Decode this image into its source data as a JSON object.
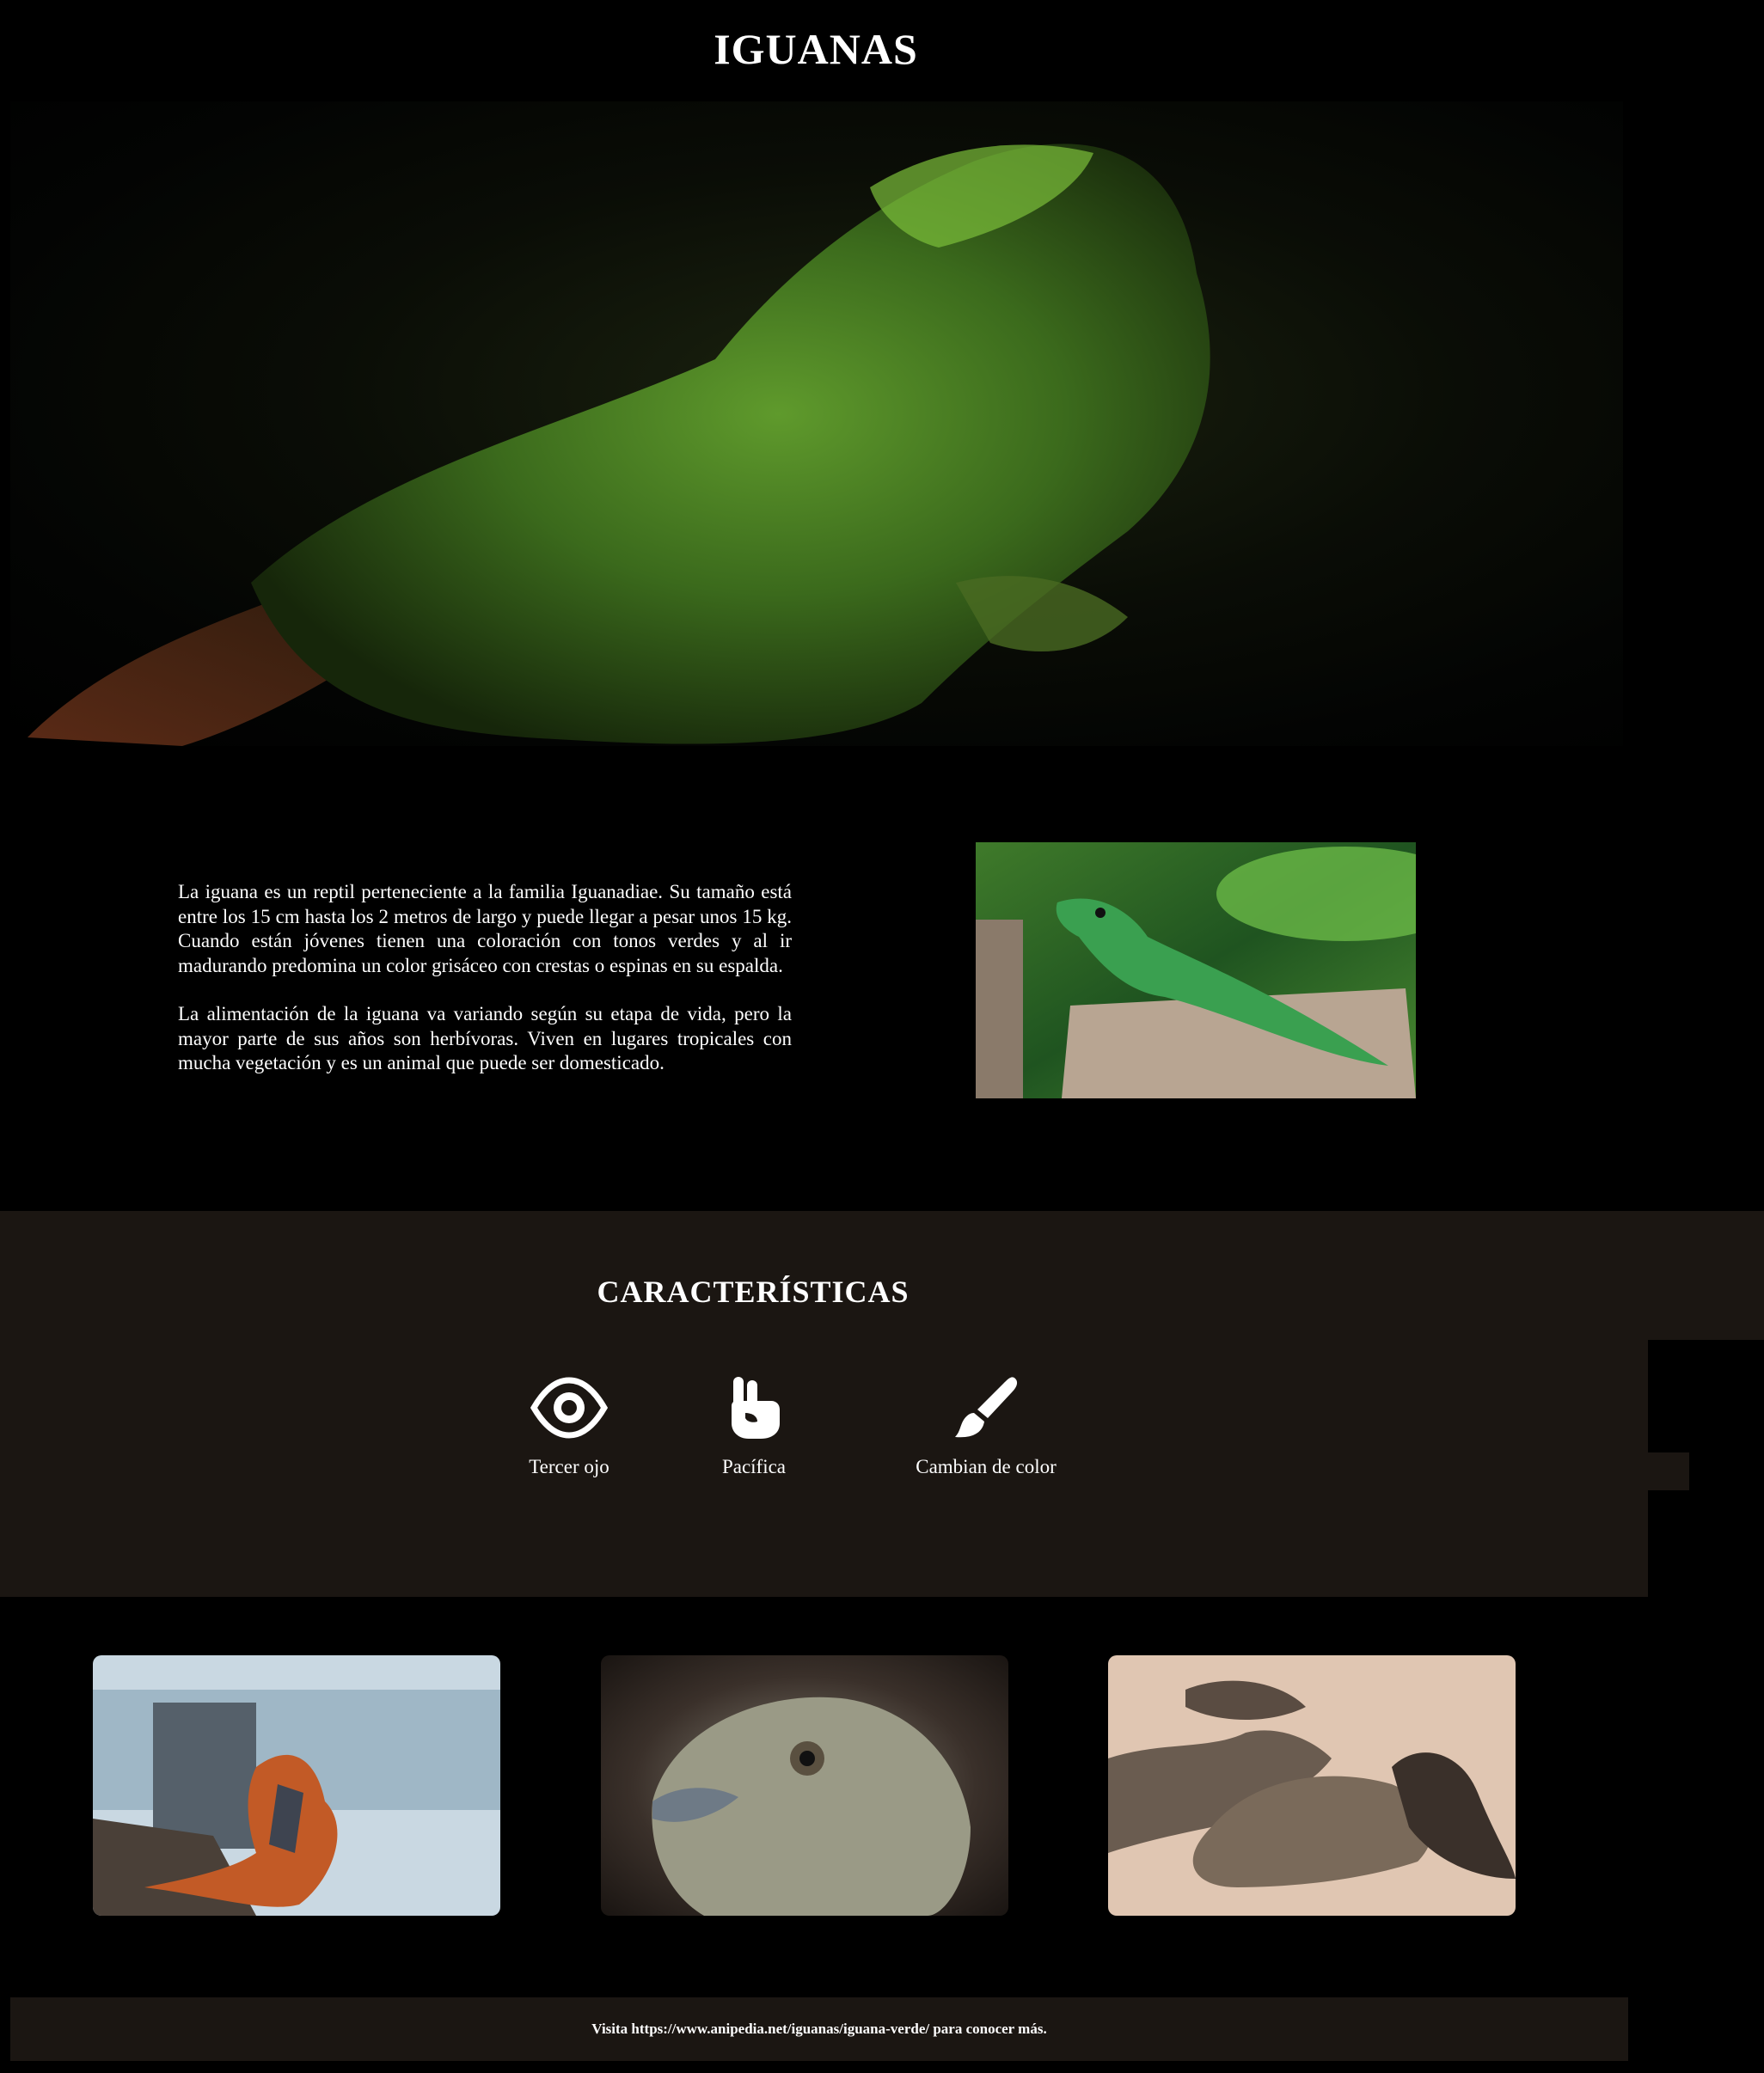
{
  "header": {
    "title": "IGUANAS"
  },
  "hero": {
    "image_alt": "Iguana verde sobre fondo oscuro"
  },
  "intro": {
    "paragraphs": [
      "La iguana es un reptil perteneciente a la familia Iguanadiae. Su tamaño está entre los 15 cm hasta los 2 metros de largo y puede llegar a pesar unos 15 kg. Cuando están jóvenes tienen una coloración con tonos verdes y al ir madurando predomina un color grisáceo con crestas o espinas en su espalda.",
      "La alimentación de la iguana va variando según su etapa de vida, pero la mayor parte de sus años son herbívoras. Viven en lugares tropicales con mucha vegetación y es un animal que puede ser domesticado."
    ],
    "photo_alt": "Iguana verde sobre un tronco"
  },
  "features": {
    "title": "CARACTERÍSTICAS",
    "items": [
      {
        "label": "Tercer ojo",
        "icon": "eye-icon"
      },
      {
        "label": "Pacífica",
        "icon": "peace-hand-icon"
      },
      {
        "label": "Cambian de color",
        "icon": "paintbrush-icon"
      }
    ]
  },
  "gallery": {
    "items": [
      {
        "alt": "Iguana naranja junto al agua"
      },
      {
        "alt": "Primer plano de la cabeza de una iguana"
      },
      {
        "alt": "Grupo de iguanas en la arena"
      }
    ]
  },
  "footer": {
    "text": "Visita https://www.anipedia.net/iguanas/iguana-verde/ para conocer más."
  },
  "colors": {
    "background": "#000000",
    "section": "#1b1612",
    "text": "#ffffff"
  }
}
